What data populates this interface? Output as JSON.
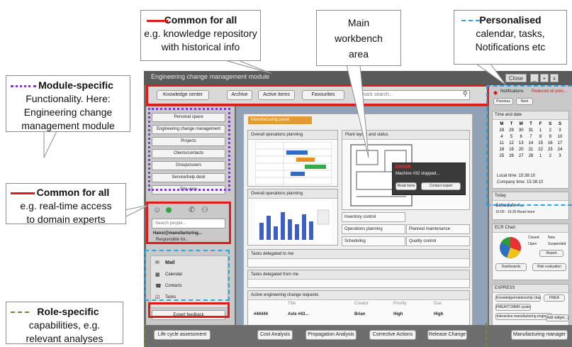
{
  "callouts": {
    "common_top": {
      "title": "Common for all",
      "line1": "e.g. knowledge repository",
      "line2": "with historical info"
    },
    "main": {
      "line1": "Main",
      "line2": "workbench",
      "line3": "area"
    },
    "personalised": {
      "title": "Personalised",
      "line1": "calendar, tasks,",
      "line2": "Notifications etc"
    },
    "module": {
      "title": "Module-specific",
      "line1": "Functionality. Here:",
      "line2": "Engineering change",
      "line3": "management module"
    },
    "common_left": {
      "title": "Common for all",
      "line1": "e.g. real-time access",
      "line2": "to domain experts"
    },
    "role": {
      "title": "Role-specific",
      "line1": "capabilities, e.g.",
      "line2": "relevant analyses"
    }
  },
  "app": {
    "title": "Engineering change management module",
    "window_close": "Close",
    "toolbar": {
      "knowledge": "Knowledge center",
      "archive": "Archive",
      "active": "Active items",
      "favourites": "Favourites",
      "search_placeholder": "Quick search..."
    },
    "module_menu": [
      "Personal space",
      "Engineering change management",
      "Projects",
      "Clients/contacts",
      "Groups/users",
      "Service/help desk",
      "Site view"
    ],
    "experts": {
      "search_placeholder": "Search people...",
      "name": "Hansi@manufacturing...",
      "role": "Responsible for..."
    },
    "comms": [
      "Mail",
      "Calendar",
      "Contacts",
      "Tasks"
    ],
    "expert_feedback": "Expert feedback",
    "panel_title": "Manufacturing panel",
    "widgets": {
      "overall1": "Overall operations planning",
      "plant": "Plant layout and status",
      "overall2": "Overall operations planning",
      "inventory": "Inventory control",
      "operations": "Operations planning",
      "planned": "Planned maintenance",
      "scheduling": "Scheduling",
      "quality": "Quality control",
      "delegated_to": "Tasks delegated to me",
      "delegated_by": "Tasks delegated from me",
      "active_requests": "Active engineering change requests"
    },
    "alert": {
      "label": "ERROR",
      "message": "Machine #32 stopped...",
      "btn_read": "Read more",
      "btn_expert": "Contact expert"
    },
    "table": {
      "columns": [
        "Title",
        "Creator",
        "Priority",
        "Due"
      ],
      "row": [
        "#44444",
        "Axle #43...",
        "Brian",
        "High",
        "High"
      ]
    },
    "right": {
      "notifications": "Notifications",
      "notif_text": "Reduced oil pres...",
      "previous": "Previous",
      "next": "Next",
      "time_date": "Time and date",
      "local_time": "Local time: 15:38:10",
      "company_time": "Company time: 15:38:10",
      "today": "Today",
      "schedule": "Schedule #...",
      "schedule_sub": "15:00 - 16:30 Read more",
      "ecr_chart": "ECR Chart",
      "legend": [
        "Closed",
        "New",
        "Open",
        "Suspended"
      ],
      "report": "Report",
      "dashboards": "Dashboards",
      "risk": "Risk evaluation",
      "express": "EXPRESS",
      "express_items": [
        "Knowledge/relationship chart",
        "FMEA",
        "FMEA/TCMMR systems",
        "Interactive manufacturing engineer"
      ],
      "add_widget": "Add widget..."
    },
    "bottom_buttons": [
      "Life cycle assessment",
      "Cost Analysis",
      "Propagation Analysis",
      "Corrective Actions",
      "Release Change",
      "Manufacturing manager"
    ]
  },
  "calendar": {
    "headers": [
      "M",
      "T",
      "W",
      "T",
      "F",
      "S",
      "S"
    ],
    "rows": [
      [
        "28",
        "29",
        "30",
        "31",
        "1",
        "2",
        "3"
      ],
      [
        "4",
        "5",
        "6",
        "7",
        "8",
        "9",
        "10"
      ],
      [
        "11",
        "12",
        "13",
        "14",
        "15",
        "16",
        "17"
      ],
      [
        "18",
        "19",
        "20",
        "21",
        "22",
        "23",
        "24"
      ],
      [
        "25",
        "26",
        "27",
        "28",
        "1",
        "2",
        "3"
      ]
    ]
  }
}
